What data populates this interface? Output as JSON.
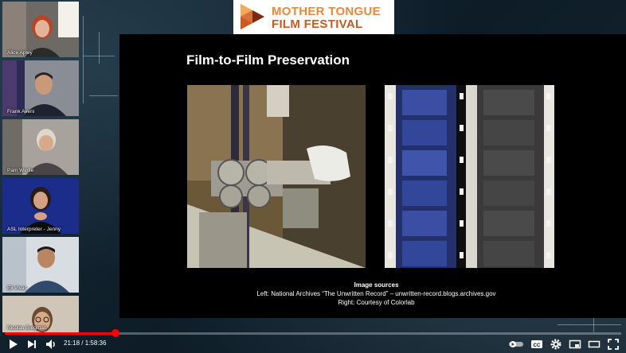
{
  "logo": {
    "line1": "MOTHER TONGUE",
    "line2": "FILM FESTIVAL",
    "colors": [
      "#e8893a",
      "#c95a22",
      "#7a2a12"
    ]
  },
  "slide": {
    "title": "Film-to-Film Preservation",
    "sources_heading": "Image sources",
    "sources_left": "Left: National Archives “The Unwritten Record” – unwritten-record.blogs.archives.gov",
    "sources_right": "Right: Courtesy of Colorlab"
  },
  "participants": [
    {
      "name": "Alice Apley"
    },
    {
      "name": "Frank Aveni"
    },
    {
      "name": "Pam Wintle"
    },
    {
      "name": "ASL Interpreter - Jenny"
    },
    {
      "name": "Eli Vivas"
    },
    {
      "name": "Nicolas Bregman"
    }
  ],
  "player": {
    "current_time": "21:18",
    "separator": " / ",
    "duration": "1:58:36",
    "progress_fraction": 0.18,
    "accent_color": "#ff0000"
  },
  "icons": {
    "play": "play-icon",
    "next": "next-icon",
    "volume": "volume-icon",
    "autoplay": "autoplay-toggle-icon",
    "captions": "captions-icon",
    "settings": "settings-gear-icon",
    "miniplayer": "miniplayer-icon",
    "theater": "theater-mode-icon",
    "fullscreen": "fullscreen-icon"
  }
}
